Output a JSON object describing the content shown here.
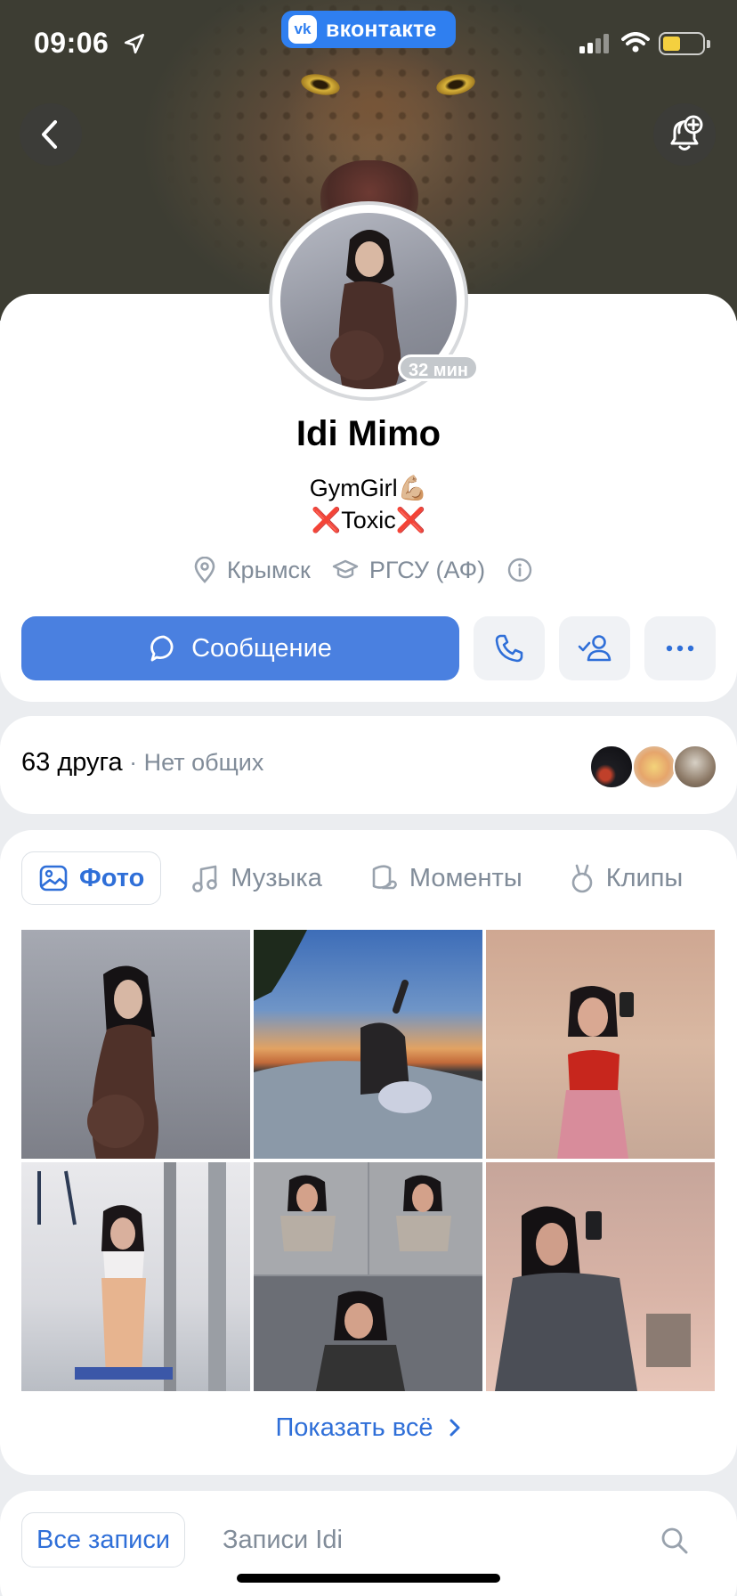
{
  "status_bar": {
    "time": "09:06",
    "app_badge": "вконтакте",
    "battery_color": "#f4d03f"
  },
  "profile": {
    "name": "Idi Mimo",
    "last_seen": "32 мин",
    "status_line_1": "GymGirl💪🏼",
    "status_line_2": "❌Toxic❌",
    "city": "Крымск",
    "university": "РГСУ (АФ)"
  },
  "actions": {
    "message_label": "Сообщение"
  },
  "friends": {
    "count_label": "63 друга",
    "separator": " · ",
    "mutual_label": "Нет общих"
  },
  "media_tabs": [
    {
      "label": "Фото",
      "icon": "photo-icon",
      "active": true
    },
    {
      "label": "Музыка",
      "icon": "music-note-icon",
      "active": false
    },
    {
      "label": "Моменты",
      "icon": "moments-icon",
      "active": false
    },
    {
      "label": "Клипы",
      "icon": "clips-icon",
      "active": false
    }
  ],
  "photos_count_visible": 6,
  "show_all_label": "Показать всё",
  "posts": {
    "all_label": "Все записи",
    "own_label": "Записи Idi"
  },
  "colors": {
    "accent": "#4a80e0",
    "link": "#2f6fd8",
    "secondary_text": "#818c99",
    "background": "#ebedf0"
  }
}
